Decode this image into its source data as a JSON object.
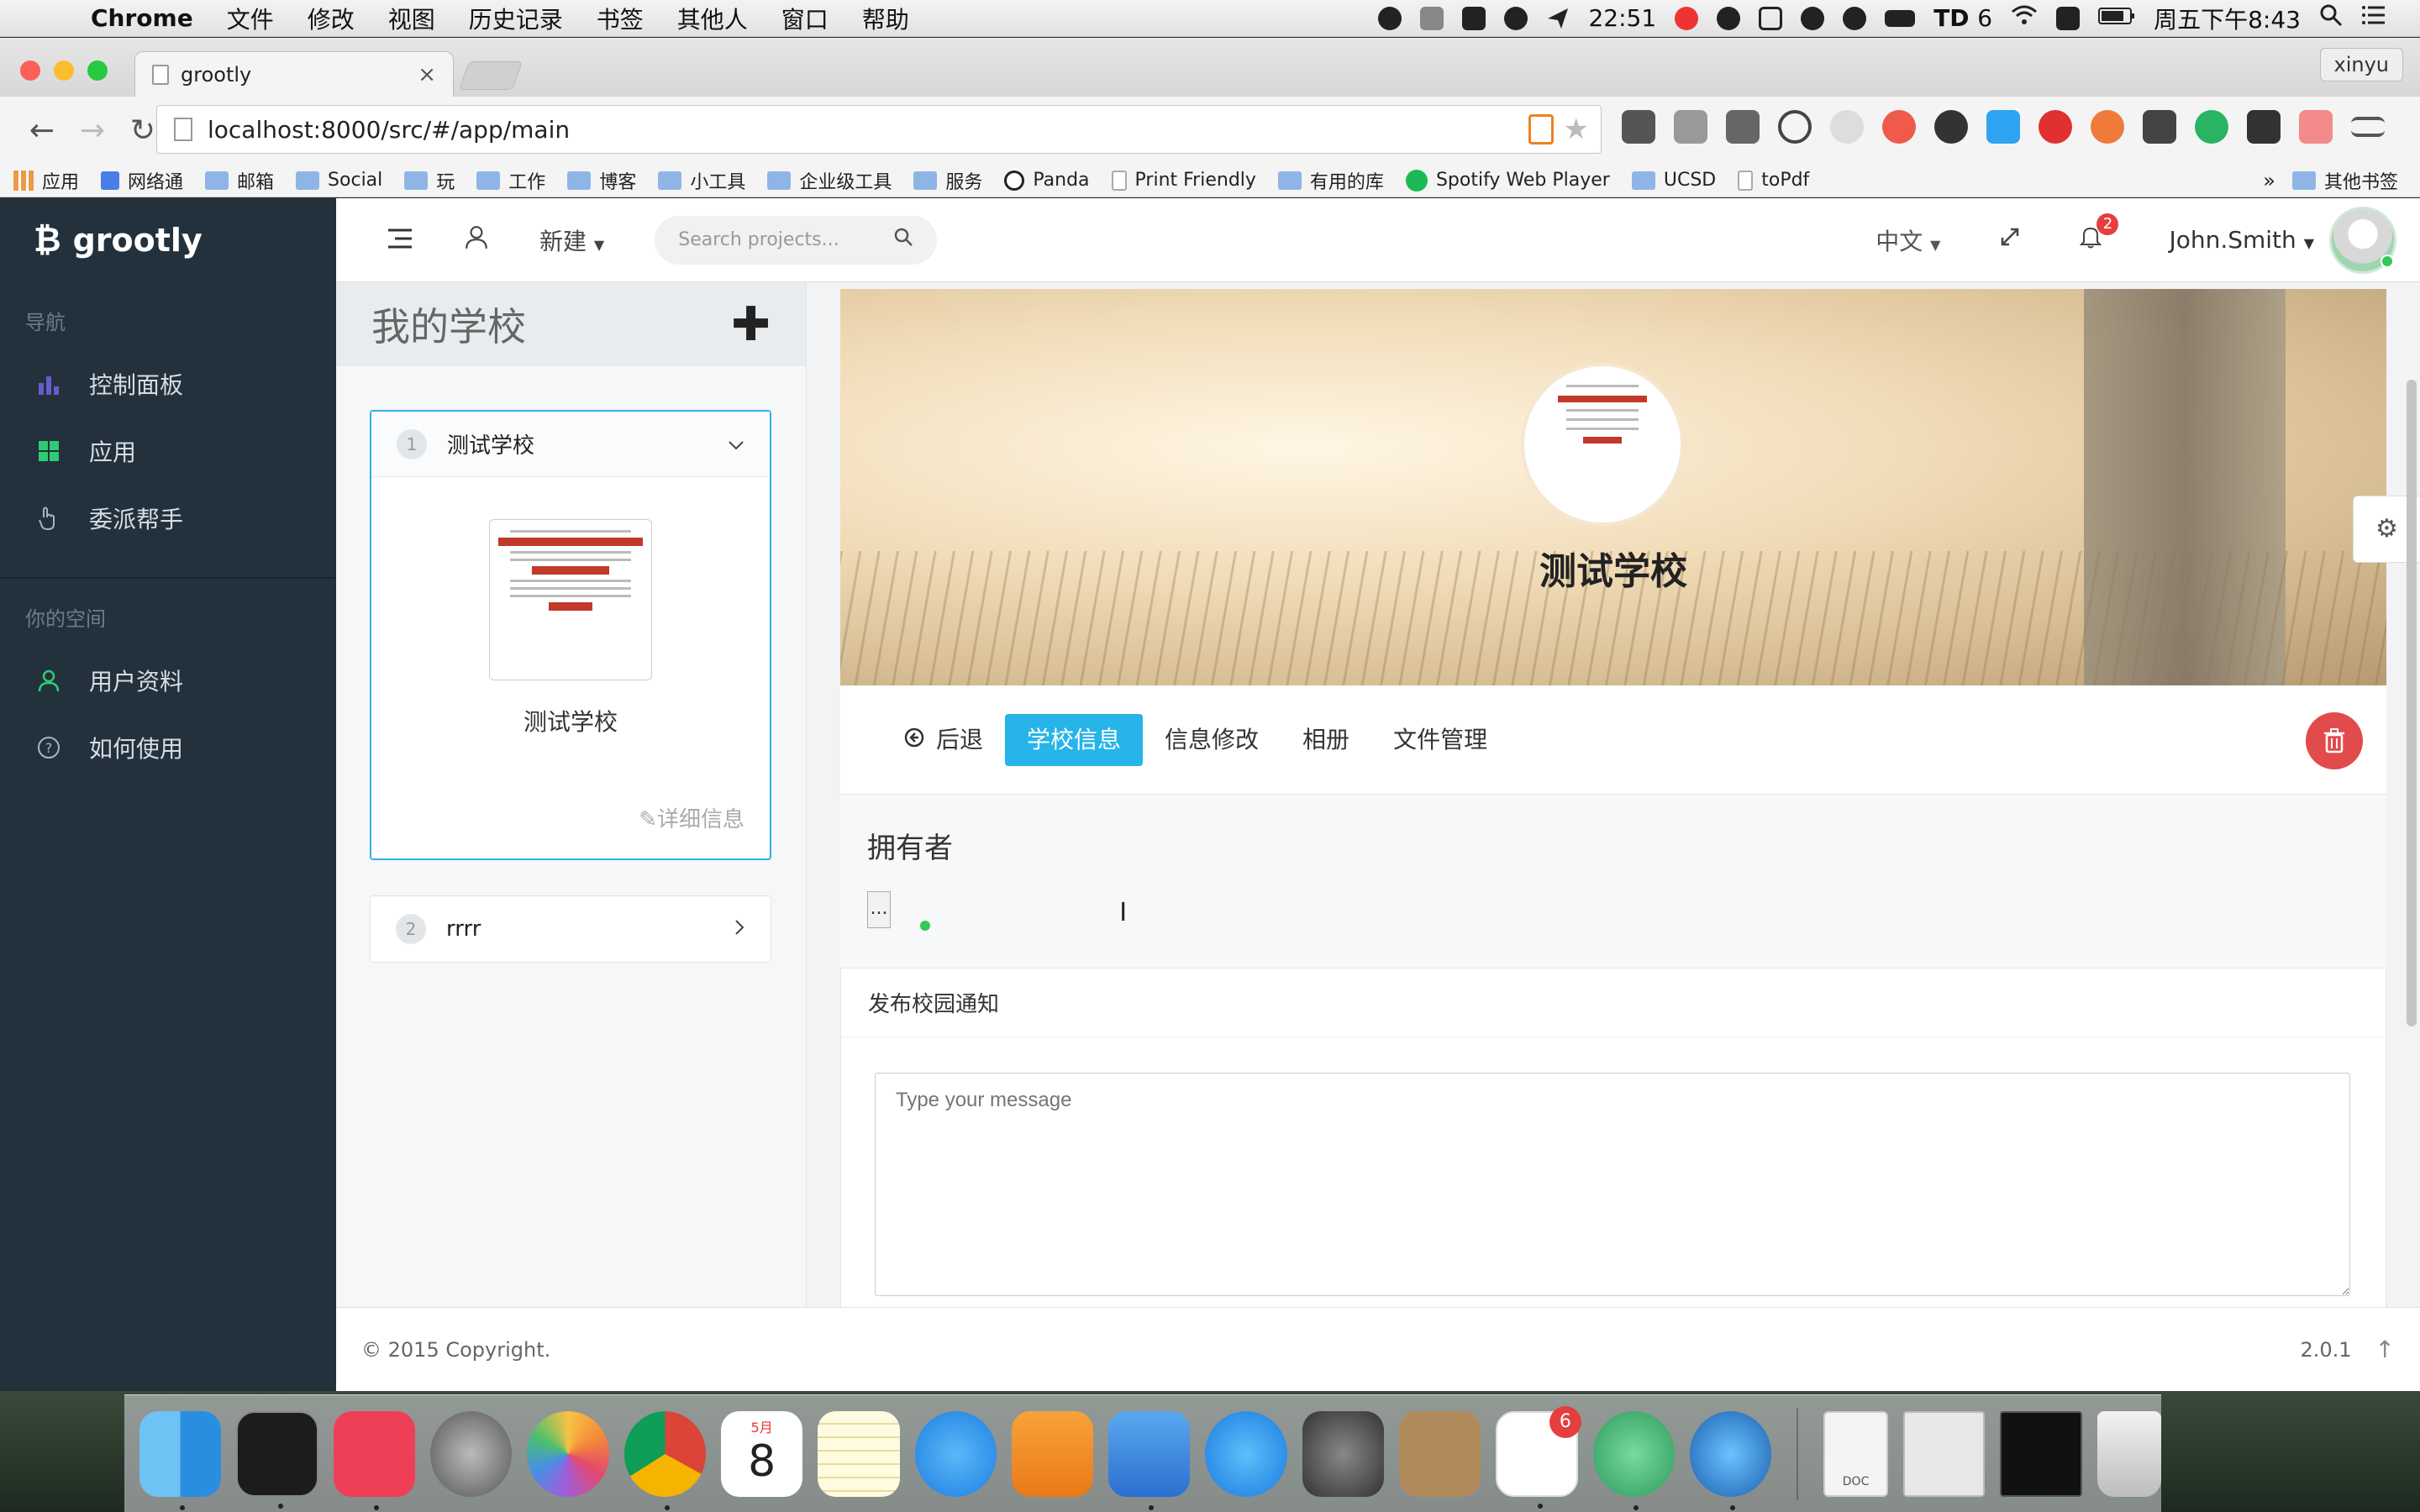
{
  "menubar": {
    "app_name": "Chrome",
    "items": [
      "文件",
      "修改",
      "视图",
      "历史记录",
      "书签",
      "其他人",
      "窗口",
      "帮助"
    ],
    "time": "22:51",
    "td_count": "6",
    "clock": "周五下午8:43"
  },
  "browser": {
    "tab_title": "grootly",
    "tab_close": "×",
    "profile": "xinyu",
    "url": "localhost:8000/src/#/app/main",
    "bookmarks": [
      "应用",
      "网络通",
      "邮箱",
      "Social",
      "玩",
      "工作",
      "博客",
      "小工具",
      "企业级工具",
      "服务",
      "Panda",
      "Print Friendly",
      "有用的库",
      "Spotify Web Player",
      "UCSD",
      "toPdf"
    ],
    "bookmarks_more": "»",
    "other_bookmarks": "其他书签"
  },
  "sidebar": {
    "brand": "grootly",
    "nav_title": "导航",
    "items": [
      {
        "label": "控制面板",
        "icon": "bar-chart-icon",
        "color": "#6a5acd"
      },
      {
        "label": "应用",
        "icon": "grid-icon",
        "color": "#2ecc71"
      },
      {
        "label": "委派帮手",
        "icon": "hand-pointer-icon",
        "color": "#aab4bd"
      }
    ],
    "space_title": "你的空间",
    "space_items": [
      {
        "label": "用户资料",
        "icon": "user-icon",
        "color": "#2ecc71"
      },
      {
        "label": "如何使用",
        "icon": "question-icon",
        "color": "#aab4bd"
      }
    ]
  },
  "header": {
    "new_label": "新建",
    "search_placeholder": "Search projects...",
    "language": "中文",
    "notifications": "2",
    "username": "John.Smith"
  },
  "left_panel": {
    "title": "我的学校",
    "schools": [
      {
        "num": "1",
        "name": "测试学校",
        "detail": "详细信息",
        "thumb_title": "测试学校"
      },
      {
        "num": "2",
        "name": "rrrr"
      }
    ]
  },
  "main": {
    "school_name": "测试学校",
    "tabs": {
      "back": "后退",
      "info": "学校信息",
      "edit": "信息修改",
      "album": "相册",
      "files": "文件管理"
    },
    "owner_title": "拥有者",
    "owner_placeholder": "...",
    "notice_title": "发布校园通知",
    "notice_placeholder": "Type your message"
  },
  "footer": {
    "copyright": "© 2015 Copyright.",
    "version": "2.0.1"
  },
  "dock": {
    "calendar_month": "5月",
    "calendar_day": "8",
    "td_badge": "6",
    "doc_label": "DOC"
  }
}
